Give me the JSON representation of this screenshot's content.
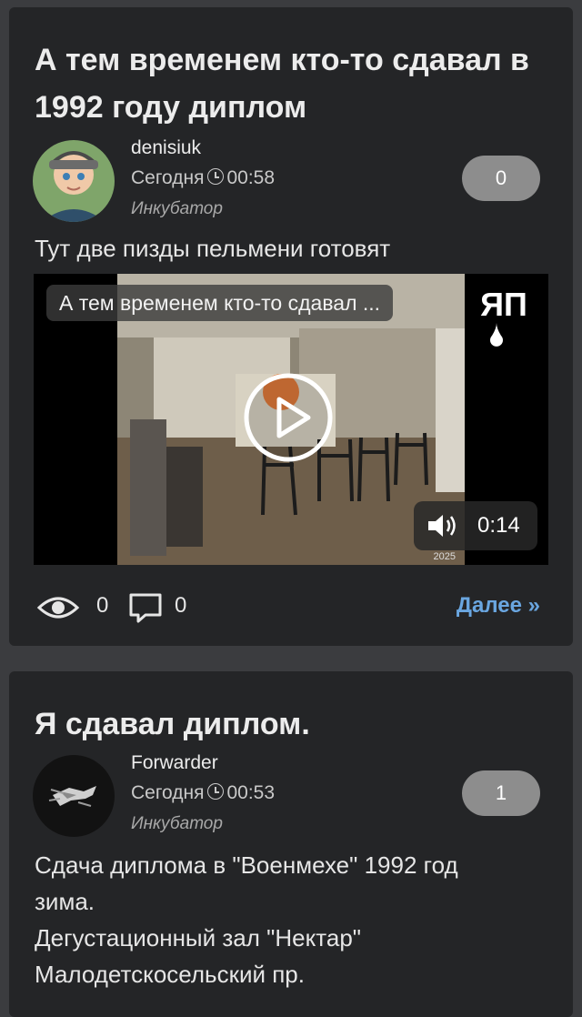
{
  "posts": [
    {
      "title": "А тем временем кто-то сдавал в 1992 году диплом",
      "author": "denisiuk",
      "date": "Сегодня",
      "time": "00:58",
      "category": "Инкубатор",
      "score": "0",
      "text": "Тут две пизды пельмени готовят",
      "video": {
        "title": "А тем временем кто-то сдавал ...",
        "duration": "0:14",
        "watermark": "2025"
      },
      "views": "0",
      "comments": "0",
      "more_label": "Далее »"
    },
    {
      "title": "Я сдавал диплом.",
      "author": "Forwarder",
      "date": "Сегодня",
      "time": "00:53",
      "category": "Инкубатор",
      "score": "1",
      "text_lines": [
        "Сдача диплома в \"Военмехе\" 1992 год",
        "зима.",
        "Дегустационный зал \"Нектар\"",
        "Малодетскосельский пр."
      ]
    }
  ],
  "logo_text": "ЯП",
  "colors": {
    "background": "#3b3c3f",
    "card": "#242527",
    "score_pill": "#8d8d8d",
    "link": "#6aa6e0"
  }
}
